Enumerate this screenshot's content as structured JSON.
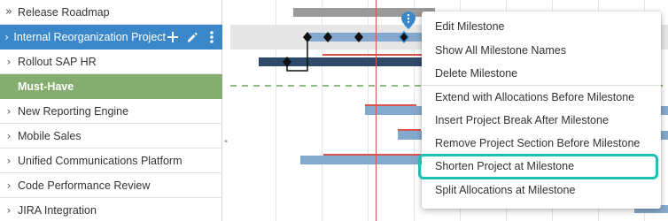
{
  "sidebar": {
    "rows": [
      {
        "chevron": "»",
        "label": "Release Roadmap",
        "type": "group"
      },
      {
        "chevron": "›",
        "label": "Internal Reorganization Project",
        "type": "selected"
      },
      {
        "chevron": "›",
        "label": "Rollout SAP HR",
        "type": "normal"
      },
      {
        "chevron": "",
        "label": "Must-Have",
        "type": "section"
      },
      {
        "chevron": "›",
        "label": "New Reporting Engine",
        "type": "normal"
      },
      {
        "chevron": "›",
        "label": "Mobile Sales",
        "type": "normal"
      },
      {
        "chevron": "›",
        "label": "Unified Communications Platform",
        "type": "normal"
      },
      {
        "chevron": "›",
        "label": "Code Performance Review",
        "type": "normal"
      },
      {
        "chevron": "›",
        "label": "JIRA Integration",
        "type": "normal"
      }
    ],
    "row_actions": [
      "plus-icon",
      "pencil-icon",
      "more-vertical-icon"
    ],
    "resize_handle": "\""
  },
  "context_menu": {
    "items": [
      {
        "label": "Edit Milestone"
      },
      {
        "label": "Show All Milestone Names"
      },
      {
        "label": "Delete Milestone"
      },
      {
        "label": "Extend with Allocations Before Milestone"
      },
      {
        "label": "Insert Project Break After Milestone"
      },
      {
        "label": "Remove Project Section Before Milestone"
      },
      {
        "label": "Shorten Project at Milestone",
        "highlighted": true
      },
      {
        "label": "Split Allocations at Milestone"
      }
    ]
  },
  "colors": {
    "selected_row": "#3a87c9",
    "section_row": "#85ad6f",
    "bar_light": "#85a9cc",
    "bar_dark": "#2d4a6b",
    "bar_gray": "#9a9a9a",
    "today_line": "#d9534f",
    "highlight_outline": "#1fbfb2",
    "milestone": "#111111"
  }
}
